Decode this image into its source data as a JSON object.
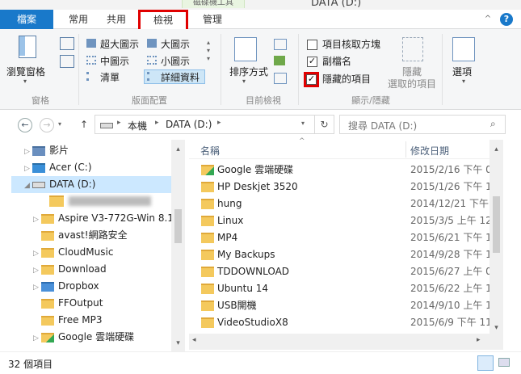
{
  "window": {
    "title": "DATA (D:)",
    "context_tab": "磁碟機工具"
  },
  "tabs": {
    "file": "檔案",
    "home": "常用",
    "share": "共用",
    "view": "檢視",
    "manage": "管理"
  },
  "ribbon": {
    "panes": {
      "nav_pane": "瀏覽窗格",
      "group": "窗格"
    },
    "layout": {
      "extra_large": "超大圖示",
      "large": "大圖示",
      "medium": "中圖示",
      "small": "小圖示",
      "list": "清單",
      "details": "詳細資料",
      "group": "版面配置"
    },
    "current_view": {
      "sort_by": "排序方式",
      "group": "目前檢視"
    },
    "show_hide": {
      "item_checkboxes": "項目核取方塊",
      "file_ext": "副檔名",
      "hidden_items": "隱藏的項目",
      "hide_selected_line1": "隱藏",
      "hide_selected_line2": "選取的項目",
      "group": "顯示/隱藏"
    },
    "options": "選項",
    "checkbox_states": {
      "item_checkboxes": false,
      "file_ext": true,
      "hidden_items": true
    }
  },
  "address": {
    "path_root": "本機",
    "path_drive": "DATA (D:)",
    "search_placeholder": "搜尋 DATA (D:)"
  },
  "nav_tree": [
    {
      "label": "影片"
    },
    {
      "label": "Acer (C:)"
    },
    {
      "label": "DATA (D:)"
    },
    {
      "label": ""
    },
    {
      "label": "Aspire V3-772G-Win 8.1"
    },
    {
      "label": "avast!網路安全"
    },
    {
      "label": "CloudMusic"
    },
    {
      "label": "Download"
    },
    {
      "label": "Dropbox"
    },
    {
      "label": "FFOutput"
    },
    {
      "label": "Free MP3"
    },
    {
      "label": "Google 雲端硬碟"
    }
  ],
  "columns": {
    "name": "名稱",
    "date": "修改日期"
  },
  "files": [
    {
      "name": "Google 雲端硬碟",
      "date": "2015/2/16 下午 0..."
    },
    {
      "name": "HP Deskjet 3520",
      "date": "2015/1/26 下午 1..."
    },
    {
      "name": "hung",
      "date": "2014/12/21 下午 ..."
    },
    {
      "name": "Linux",
      "date": "2015/3/5 上午 12..."
    },
    {
      "name": "MP4",
      "date": "2015/6/21 下午 1..."
    },
    {
      "name": "My Backups",
      "date": "2014/9/28 下午 1..."
    },
    {
      "name": "TDDOWNLOAD",
      "date": "2015/6/27 上午 0..."
    },
    {
      "name": "Ubuntu 14",
      "date": "2015/6/22 上午 1..."
    },
    {
      "name": "USB開機",
      "date": "2014/9/10 上午 1..."
    },
    {
      "name": "VideoStudioX8",
      "date": "2015/6/9 下午 11..."
    }
  ],
  "status": {
    "count": "32 個項目"
  },
  "colors": {
    "accent": "#1979ca",
    "highlight": "#e00000",
    "selected": "#cce8ff"
  }
}
